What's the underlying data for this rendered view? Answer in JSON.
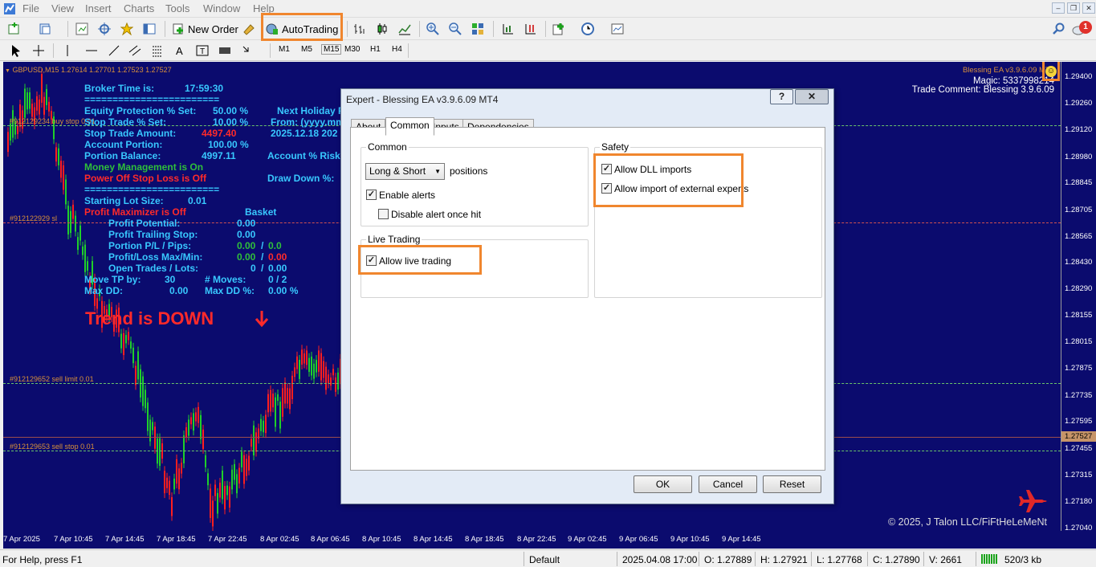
{
  "menu": [
    "File",
    "View",
    "Insert",
    "Charts",
    "Tools",
    "Window",
    "Help"
  ],
  "toolbar": {
    "new_order": "New Order",
    "autotrading": "AutoTrading",
    "notification_count": "1"
  },
  "timeframes": [
    "M1",
    "M5",
    "M15",
    "M30",
    "H1",
    "H4"
  ],
  "chart": {
    "symbol_info": "GBPUSD,M15  1.27614 1.27701 1.27523 1.27527",
    "ea_name": "Blessing EA v3.9.6.09 MT4",
    "magic": "Magic: 5337998214",
    "trade_comment": "Trade Comment: Blessing 3.9.6.09",
    "copyright": "© 2025, J Talon LLC/FiFtHeLeMeNt",
    "order_labels": [
      "#912129234 buy stop 0.01",
      "#912122929 sl",
      "#912129652 sell limit 0.01",
      "#912129653 sell stop 0.01"
    ],
    "current_price": "1.27527",
    "price_ticks": [
      "1.29400",
      "1.29260",
      "1.29120",
      "1.28980",
      "1.28845",
      "1.28705",
      "1.28565",
      "1.28430",
      "1.28290",
      "1.28155",
      "1.28015",
      "1.27875",
      "1.27735",
      "1.27595",
      "1.27455",
      "1.27315",
      "1.27180",
      "1.27040"
    ],
    "time_ticks": [
      "7 Apr 2025",
      "7 Apr 10:45",
      "7 Apr 14:45",
      "7 Apr 18:45",
      "7 Apr 22:45",
      "8 Apr 02:45",
      "8 Apr 06:45",
      "8 Apr 10:45",
      "8 Apr 14:45",
      "8 Apr 18:45",
      "8 Apr 22:45",
      "9 Apr 02:45",
      "9 Apr 06:45",
      "9 Apr 10:45",
      "9 Apr 14:45"
    ],
    "trend": "Trend is DOWN"
  },
  "ea_panel": {
    "broker_time_label": "Broker Time is:",
    "broker_time": "17:59:30",
    "sep1": "========================",
    "equity_protection_label": "Equity Protection % Set:",
    "equity_protection": "50.00 %",
    "stop_trade_pct_label": "Stop Trade % Set:",
    "stop_trade_pct": "10.00 %",
    "stop_trade_amount_label": "Stop Trade Amount:",
    "stop_trade_amount": "4497.40",
    "account_portion_label": "Account Portion:",
    "account_portion": "100.00 %",
    "portion_balance_label": "Portion Balance:",
    "portion_balance": "4997.11",
    "money_mgmt": "Money Management is On",
    "power_off_sl": "Power Off Stop Loss is Off",
    "sep2": "========================",
    "starting_lot_label": "Starting Lot Size:",
    "starting_lot": "0.01",
    "profit_max": "Profit Maximizer is Off",
    "basket": "Basket",
    "profit_potential_label": "Profit Potential:",
    "profit_potential": "0.00",
    "profit_trailing_label": "Profit Trailing Stop:",
    "profit_trailing": "0.00",
    "portion_pl_label": "Portion P/L / Pips:",
    "portion_pl_a": "0.00",
    "portion_pl_b": "0.0",
    "profit_loss_label": "Profit/Loss Max/Min:",
    "pl_max": "0.00",
    "pl_min": "0.00",
    "open_trades_label": "Open Trades / Lots:",
    "open_trades": "0",
    "open_lots": "0.00",
    "move_tp_label": "Move TP by:",
    "move_tp": "30",
    "moves_label": "# Moves:",
    "moves": "0 / 2",
    "max_dd_label": "Max DD:",
    "max_dd": "0.00",
    "max_dd_pct_label": "Max DD %:",
    "max_dd_pct": "0.00 %",
    "next_holiday": "Next Holiday P",
    "from_label": "From: (yyyy.mm",
    "holiday_date": "2025.12.18  202",
    "account_risk": "Account % Risk",
    "drawdown": "Draw Down %:"
  },
  "dialog": {
    "title": "Expert - Blessing EA v3.9.6.09 MT4",
    "tabs": [
      "About",
      "Common",
      "Inputs",
      "Dependencies"
    ],
    "common_group": "Common",
    "position_select": "Long & Short",
    "positions_label": "positions",
    "enable_alerts": "Enable alerts",
    "disable_alert": "Disable alert once hit",
    "live_group": "Live Trading",
    "allow_live": "Allow live trading",
    "safety_group": "Safety",
    "allow_dll": "Allow DLL imports",
    "allow_external": "Allow import of external experts",
    "ok": "OK",
    "cancel": "Cancel",
    "reset": "Reset",
    "help_btn": "?",
    "close_btn": "✕"
  },
  "status": {
    "help": "For Help, press F1",
    "profile": "Default",
    "datetime": "2025.04.08 17:00",
    "open": "O: 1.27889",
    "high": "H: 1.27921",
    "low": "L: 1.27768",
    "close": "C: 1.27890",
    "volume": "V: 2661",
    "traffic": "520/3 kb"
  },
  "colors": {
    "highlight": "#f0862e",
    "chart_bg": "#0b0b6e",
    "bull": "#1fcf2a",
    "bear": "#ff1e1e"
  }
}
